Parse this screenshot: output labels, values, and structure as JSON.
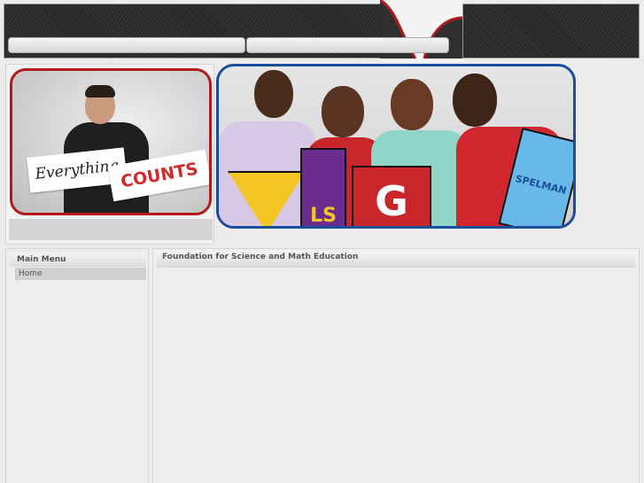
{
  "header": {
    "nav_items": [
      "",
      ""
    ]
  },
  "left_banner": {
    "card_word_1": "Everything",
    "card_word_2": "COUNTS"
  },
  "right_banner": {
    "pennants": [
      "",
      "LS",
      "G",
      "SPELMAN"
    ]
  },
  "menu": {
    "title": "Main Menu",
    "items": [
      {
        "label": "Home"
      }
    ]
  },
  "main": {
    "title": "Foundation for Science and Math Education"
  },
  "colors": {
    "accent_red": "#b01a1a",
    "accent_blue": "#1a4e9c",
    "header_dark": "#262626"
  }
}
